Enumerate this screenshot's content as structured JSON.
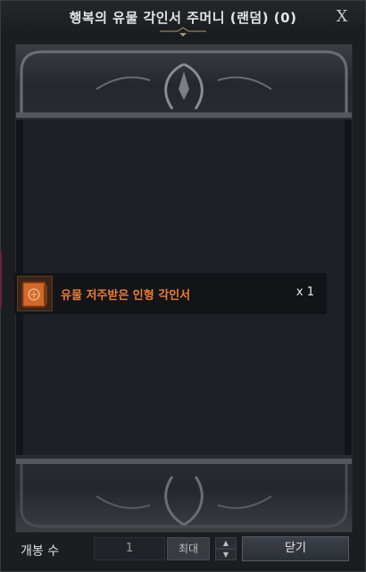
{
  "window": {
    "title": "행복의 유물 각인서 주머니 (랜덤) (0)",
    "close_label": "X"
  },
  "items": [
    {
      "name": "유물 저주받은 인형 각인서",
      "quantity": "x 1",
      "icon": "engraving-book-icon"
    }
  ],
  "footer": {
    "open_count_label": "개봉 수",
    "open_count_value": "1",
    "max_label": "최대",
    "close_button": "닫기"
  },
  "colors": {
    "item_name": "#ec7b3a",
    "background": "#1c1d21"
  }
}
